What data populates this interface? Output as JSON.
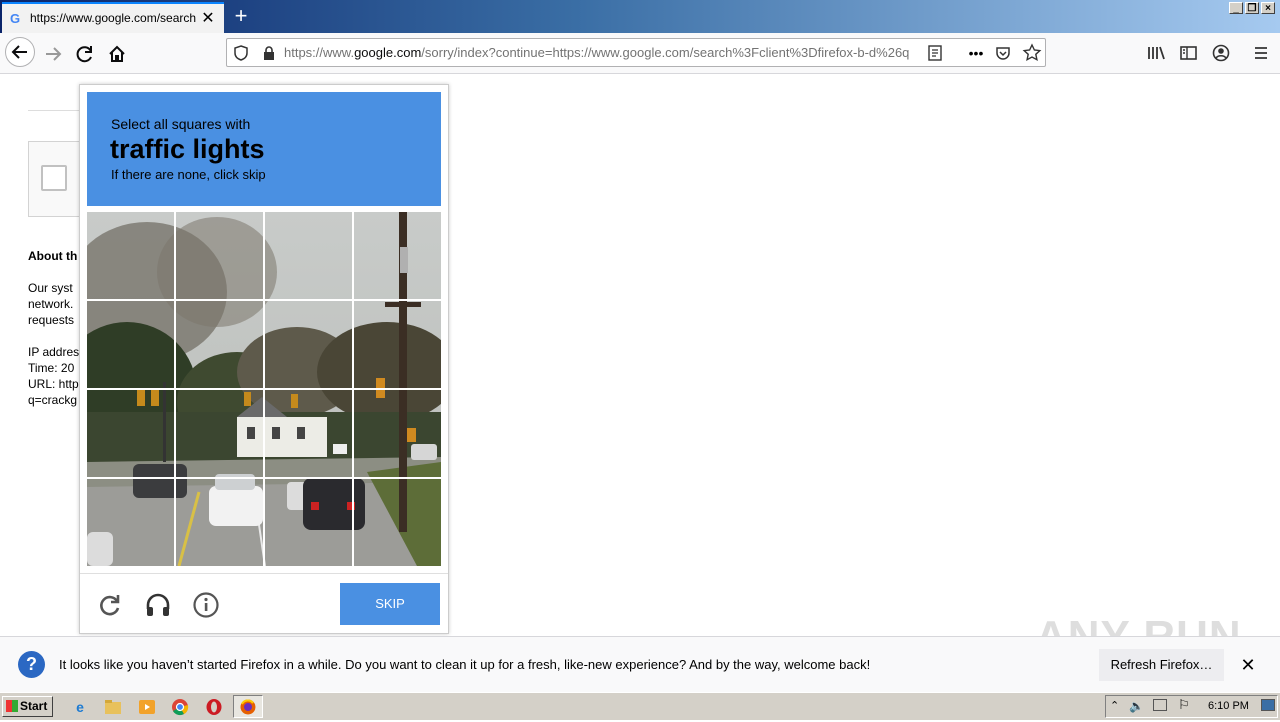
{
  "browser": {
    "tab_title": "https://www.google.com/search?client=firefox-b-d",
    "tab_favicon": "G",
    "url_host_prefix": "https://www.",
    "url_host": "google.com",
    "url_rest": "/sorry/index?continue=https://www.google.com/search%3Fclient%3Dfirefox-b-d%26q",
    "new_tab_label": "+",
    "close_tab_label": "✕"
  },
  "page": {
    "about_heading": "About th",
    "para_lines": [
      "Our syst",
      "network.",
      "requests"
    ],
    "info_lines": [
      "IP addres",
      "Time: 20",
      "URL: http",
      "q=crackg"
    ]
  },
  "captcha": {
    "instruction": "Select all squares with",
    "target": "traffic lights",
    "hint": "If there are none, click skip",
    "skip_label": "SKIP",
    "header_color": "#4a90e2"
  },
  "notification": {
    "message": "It looks like you haven’t started Firefox in a while. Do you want to clean it up for a fresh, like-new experience? And by the way, welcome back!",
    "refresh_label": "Refresh Firefox…",
    "watermark": "ANY RUN"
  },
  "taskbar": {
    "start_label": "Start",
    "clock": "6:10 PM"
  }
}
